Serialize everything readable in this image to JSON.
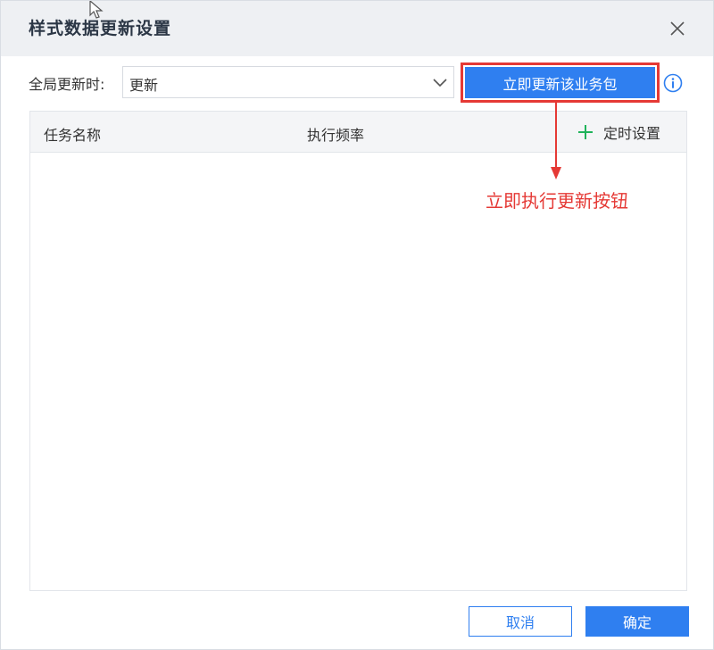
{
  "dialog": {
    "title": "样式数据更新设置",
    "close_icon": "close-icon"
  },
  "controls": {
    "global_update_label": "全局更新时:",
    "global_update_value": "更新",
    "update_now_button": "立即更新该业务包",
    "info_icon": "info-icon"
  },
  "table": {
    "columns": [
      "任务名称",
      "执行频率"
    ],
    "schedule_button": "定时设置",
    "rows": []
  },
  "annotation": {
    "text": "立即执行更新按钮",
    "color": "#e53935"
  },
  "footer": {
    "cancel": "取消",
    "confirm": "确定"
  },
  "colors": {
    "primary": "#2f7ff0",
    "accent_green": "#1fb35a",
    "highlight_red": "#e53935"
  }
}
